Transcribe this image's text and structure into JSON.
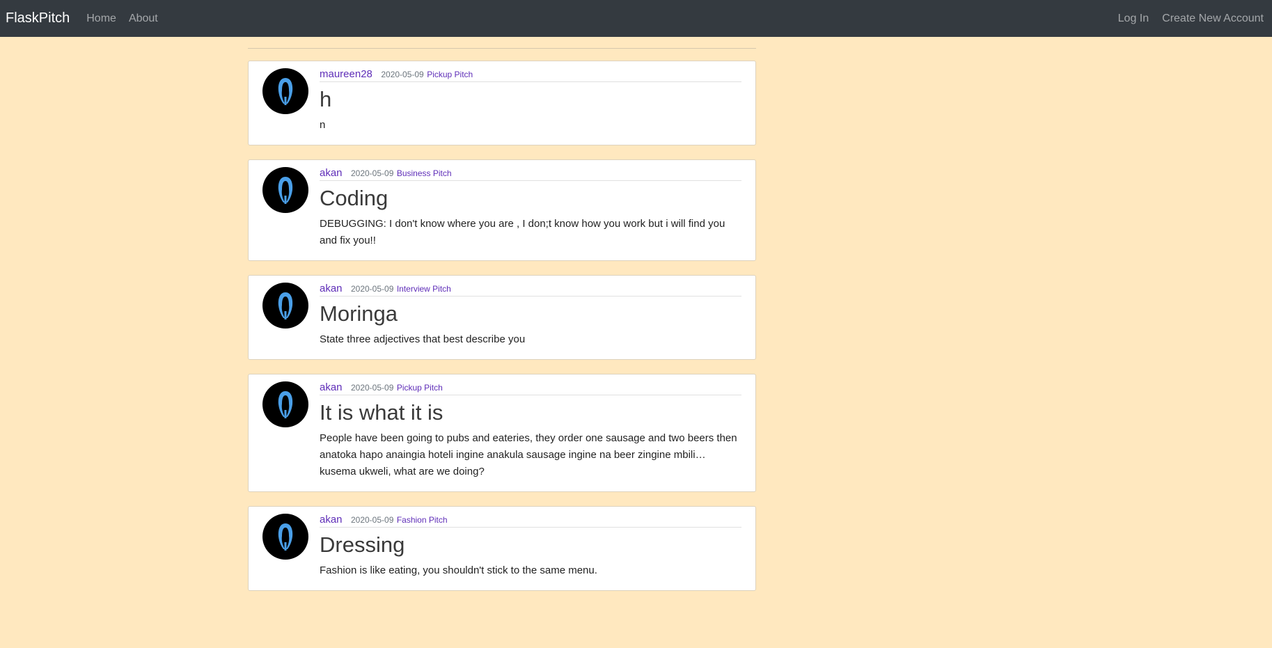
{
  "navbar": {
    "brand": "FlaskPitch",
    "links": [
      "Home",
      "About"
    ],
    "right_links": [
      "Log In",
      "Create New Account"
    ],
    "background": "#343a40"
  },
  "page": {
    "background": "#ffe8bf",
    "link_color": "#5f2eb8",
    "avatar_icon": "user-avatar-icon",
    "avatar_accent": "#4a9fe8"
  },
  "posts": [
    {
      "author": "maureen28",
      "date": "2020-05-09",
      "category": "Pickup Pitch",
      "title": "h",
      "content": "n"
    },
    {
      "author": "akan",
      "date": "2020-05-09",
      "category": "Business Pitch",
      "title": "Coding",
      "content": "DEBUGGING: I don't know where you are , I don;t know how you work but i will find you and fix you!!"
    },
    {
      "author": "akan",
      "date": "2020-05-09",
      "category": "Interview Pitch",
      "title": "Moringa",
      "content": "State three adjectives that best describe you"
    },
    {
      "author": "akan",
      "date": "2020-05-09",
      "category": "Pickup Pitch",
      "title": "It is what it is",
      "content": "People have been going to pubs and eateries, they order one sausage and two beers then anatoka hapo anaingia hoteli ingine anakula sausage ingine na beer zingine mbili… kusema ukweli, what are we doing?"
    },
    {
      "author": "akan",
      "date": "2020-05-09",
      "category": "Fashion Pitch",
      "title": "Dressing",
      "content": "Fashion is like eating, you shouldn't stick to the same menu."
    }
  ]
}
